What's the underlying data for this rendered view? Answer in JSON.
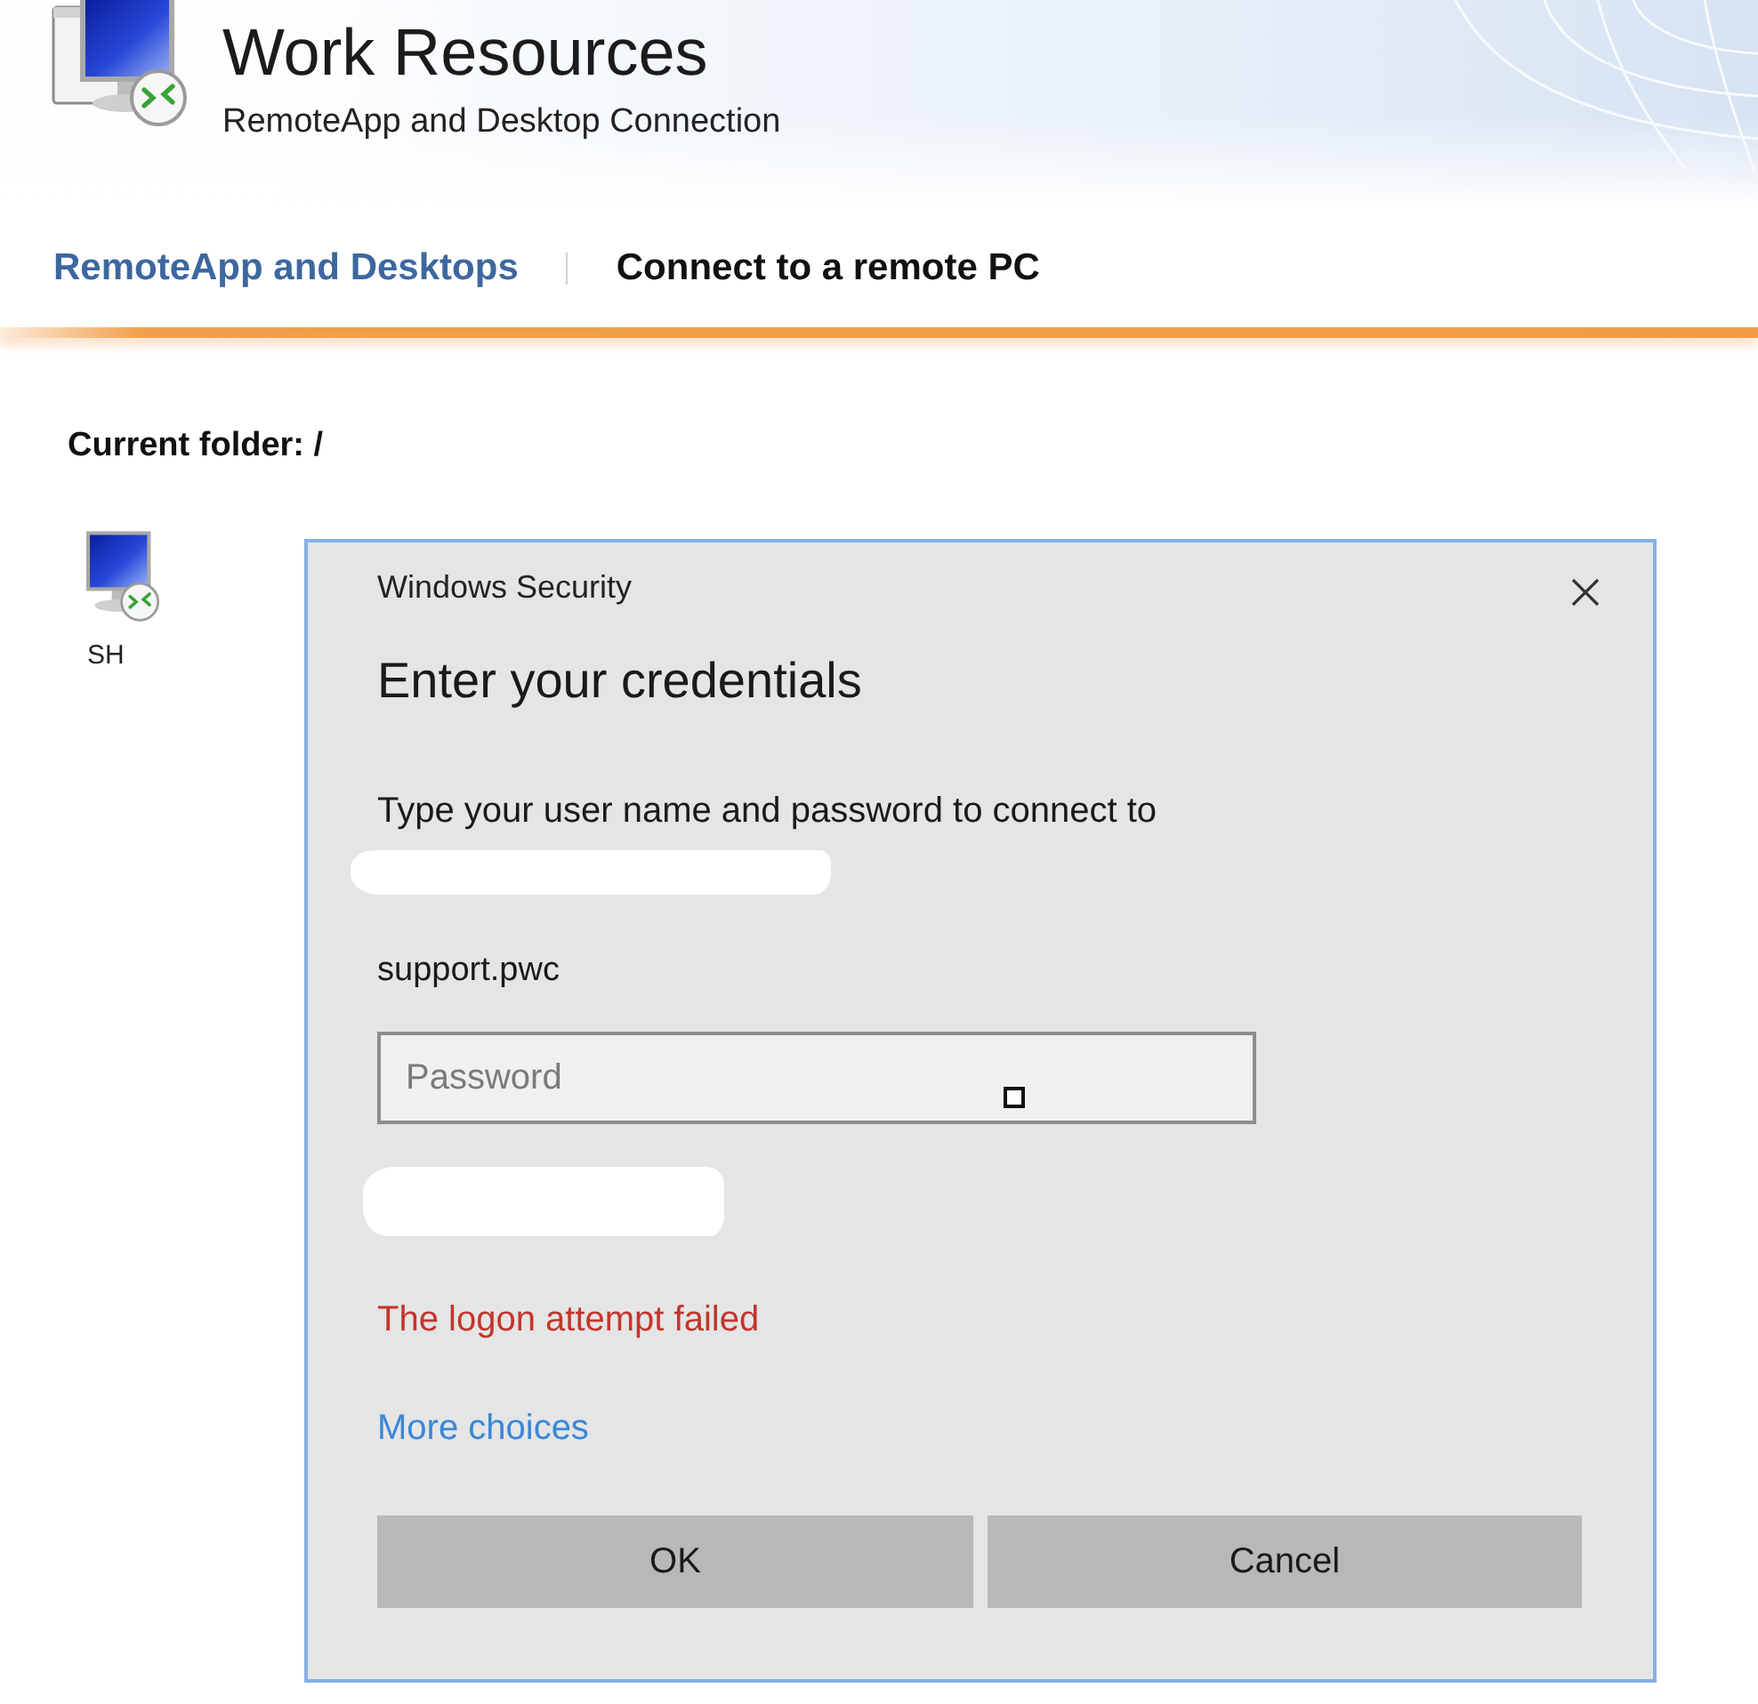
{
  "header": {
    "title": "Work Resources",
    "subtitle": "RemoteApp and Desktop Connection"
  },
  "nav": {
    "tabs": [
      {
        "label": "RemoteApp and Desktops",
        "selected": false
      },
      {
        "label": "Connect to a remote PC",
        "selected": true
      }
    ]
  },
  "folder": {
    "label": "Current folder: /"
  },
  "items": [
    {
      "label": "SH"
    }
  ],
  "dialog": {
    "title": "Windows Security",
    "heading": "Enter your credentials",
    "message": "Type your user name and password to connect to",
    "username": "support.pwc",
    "password": {
      "placeholder": "Password"
    },
    "error": "The logon attempt failed",
    "link": "More choices",
    "buttons": [
      "OK",
      "Cancel"
    ]
  }
}
